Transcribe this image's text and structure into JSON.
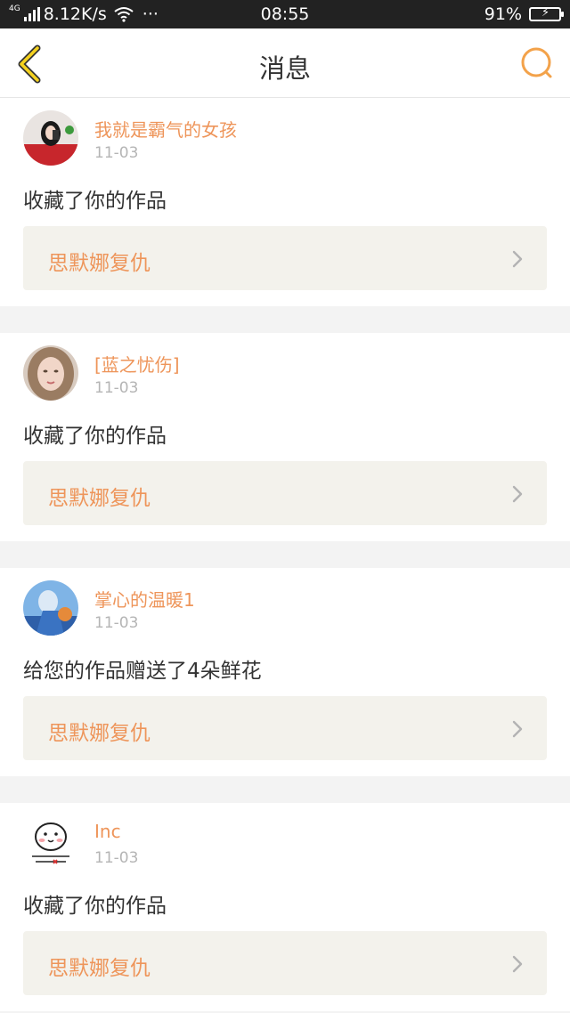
{
  "status_bar": {
    "network_type": "4G",
    "speed": "8.12K/s",
    "dots": "···",
    "time": "08:55",
    "battery": "91%",
    "battery_level": 0.91
  },
  "header": {
    "title": "消息",
    "back_icon": "chevron-left-icon",
    "search_icon": "search-icon",
    "accent": "#f3a24a"
  },
  "feed": [
    {
      "name": "我就是霸气的女孩",
      "date": "11-03",
      "action": "收藏了你的作品",
      "work": "思默娜复仇"
    },
    {
      "name": "[蓝之忧伤]",
      "date": "11-03",
      "action": "收藏了你的作品",
      "work": "思默娜复仇"
    },
    {
      "name": "掌心的温暖1",
      "date": "11-03",
      "action": "给您的作品赠送了4朵鲜花",
      "work": "思默娜复仇"
    },
    {
      "name": "Inc",
      "date": "11-03",
      "action": "收藏了你的作品",
      "work": "思默娜复仇"
    }
  ]
}
